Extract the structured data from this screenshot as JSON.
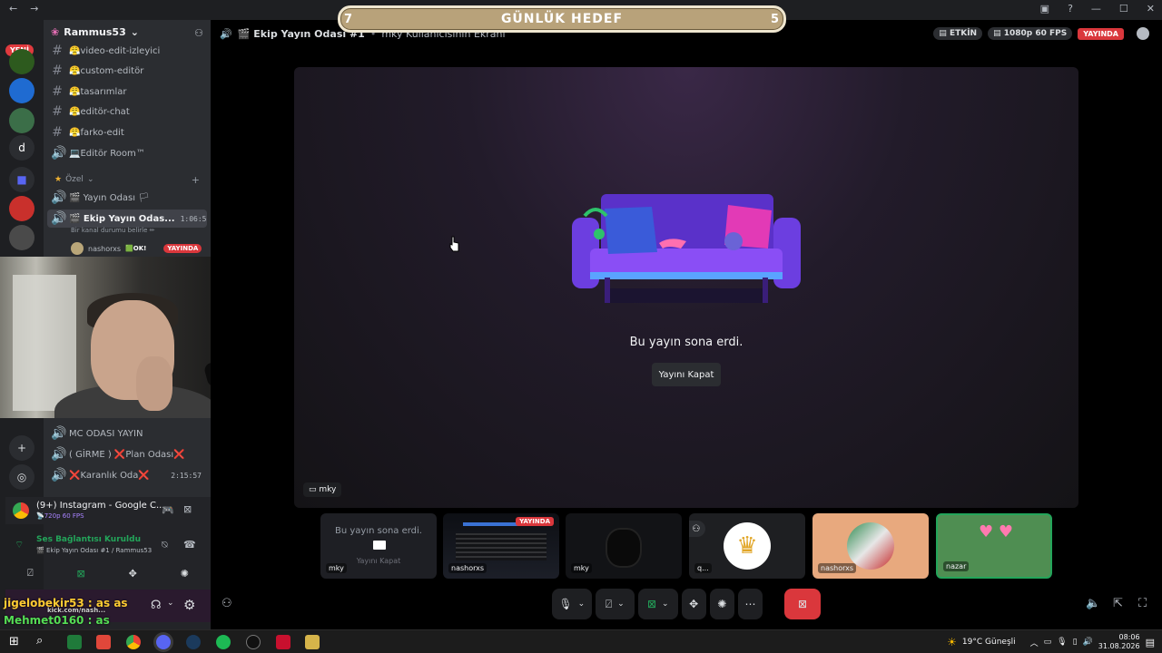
{
  "titlebar": {
    "back": "←",
    "fwd": "→"
  },
  "servers": {
    "new_badge": "YENİ",
    "d_label": "d"
  },
  "sidebar": {
    "server_name": "Rammus53",
    "channels": [
      {
        "label": "😤video-edit-izleyici"
      },
      {
        "label": "😤custom-editör"
      },
      {
        "label": "😤tasarımlar"
      },
      {
        "label": "😤editör-chat"
      },
      {
        "label": "😤farko-edit"
      },
      {
        "label": "💻Editör Room™"
      }
    ],
    "section_ozel": "Özel",
    "yayin_odasi": "🎬 Yayın Odası 🏳",
    "ekip_odasi": "🎬 Ekip Yayın Odas...",
    "ekip_time": "1:06:53",
    "ekip_status": "Bir kanal durumu belirle ✏",
    "member": "nashorxs",
    "member_ok": "🟩OK!",
    "live_label": "YAYINDA",
    "mc_odasi": "MC ODASI YAYIN",
    "plan_odasi": "( GİRME ) ❌Plan Odası❌",
    "karanlik": "❌Karanlık Oda❌",
    "karanlik_time": "2:15:57"
  },
  "panel": {
    "app_title": "(9+) Instagram - Google C...",
    "app_quality": "📡720p 60 FPS",
    "voice_status": "Ses Bağlantısı Kuruldu",
    "voice_channel": "🎬 Ekip Yayın Odası #1 / Rammus53"
  },
  "overlay_chat": {
    "line1": "jigelobekir53 : as as",
    "line1_sub": "kick.com/nash...",
    "line2": "Mehmet0160 : as"
  },
  "topbar": {
    "channel": "🎬 Ekip Yayın Odası #1",
    "screen_owner": "mky Kullanıcısının Ekranı",
    "activity": "ETKİN",
    "quality": "1080p 60 FPS",
    "live": "YAYINDA"
  },
  "goal": {
    "left": "7",
    "title": "GÜNLÜK HEDEF",
    "right": "5"
  },
  "stage": {
    "message": "Bu yayın sona erdi.",
    "button": "Yayını Kapat",
    "name": "mky"
  },
  "tiles": [
    {
      "label": "mky",
      "msg": "Bu yayın sona erdi.",
      "btn": "Yayını Kapat"
    },
    {
      "label": "nashorxs",
      "live": "YAYINDA"
    },
    {
      "label": "mky"
    },
    {
      "label": "q..."
    },
    {
      "label": "nashorxs"
    },
    {
      "label": "nazar"
    }
  ],
  "taskbar": {
    "weather": "19°C  Güneşli",
    "time": "08:06",
    "date": "31.08.2026"
  },
  "colors": {
    "live": "#da373c",
    "accent": "#5865f2",
    "end_call": "#da373c",
    "goal_bg": "#b8a27a"
  }
}
